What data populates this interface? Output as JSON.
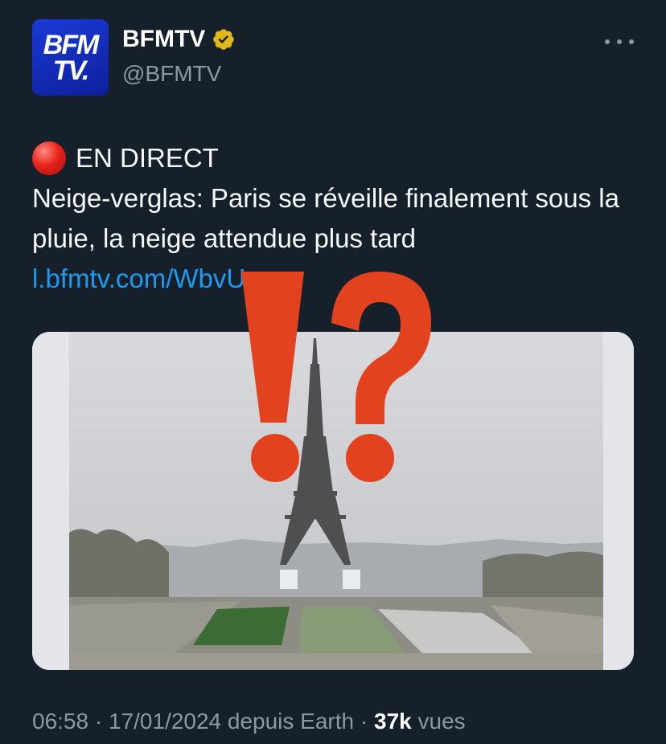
{
  "author": {
    "avatar_line1": "BFM",
    "avatar_line2": "TV.",
    "display_name": "BFMTV",
    "handle": "@BFMTV",
    "verified_icon": "verified-badge-gold"
  },
  "tweet": {
    "live_label": "EN DIRECT",
    "text": "Neige-verglas: Paris se réveille finalement sous la pluie, la neige attendue plus tard",
    "link": "l.bfmtv.com/WbvU"
  },
  "overlay": {
    "text": "!?",
    "color": "#e3421f"
  },
  "meta": {
    "time": "06:58",
    "date": "17/01/2024",
    "source": "depuis Earth",
    "views_count": "37k",
    "views_label": "vues"
  },
  "colors": {
    "background": "#15202b",
    "secondary_text": "#8b98a5",
    "link": "#1d9bf0",
    "avatar": "#1a3bd6"
  }
}
